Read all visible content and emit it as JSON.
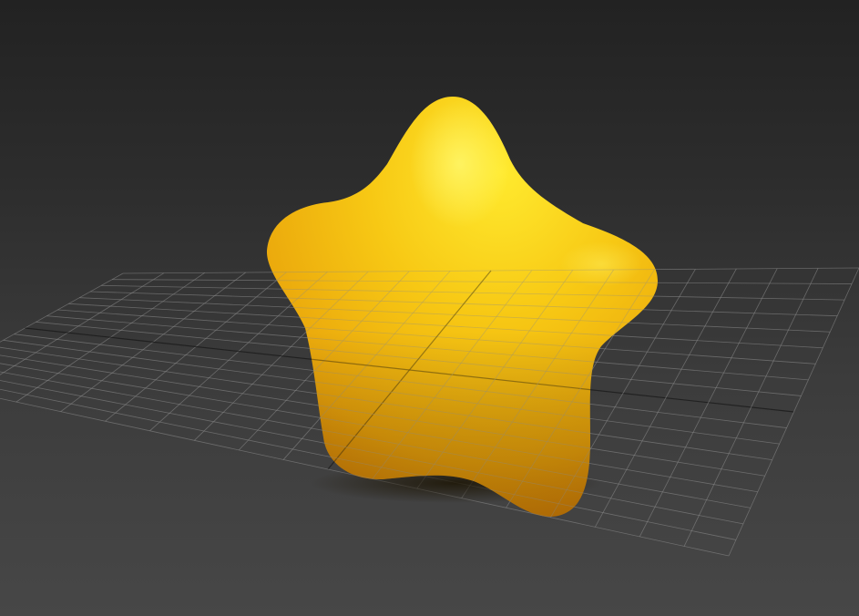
{
  "viewport": {
    "background_top": "#222222",
    "background_bottom": "#474747"
  },
  "grid": {
    "line_color": "#8a8a8a",
    "axis_color": "#101010"
  },
  "object": {
    "shape": "star",
    "color_highlight": "#ffe426",
    "color_base": "#f0b60a",
    "color_shadow": "#cf7a06"
  }
}
